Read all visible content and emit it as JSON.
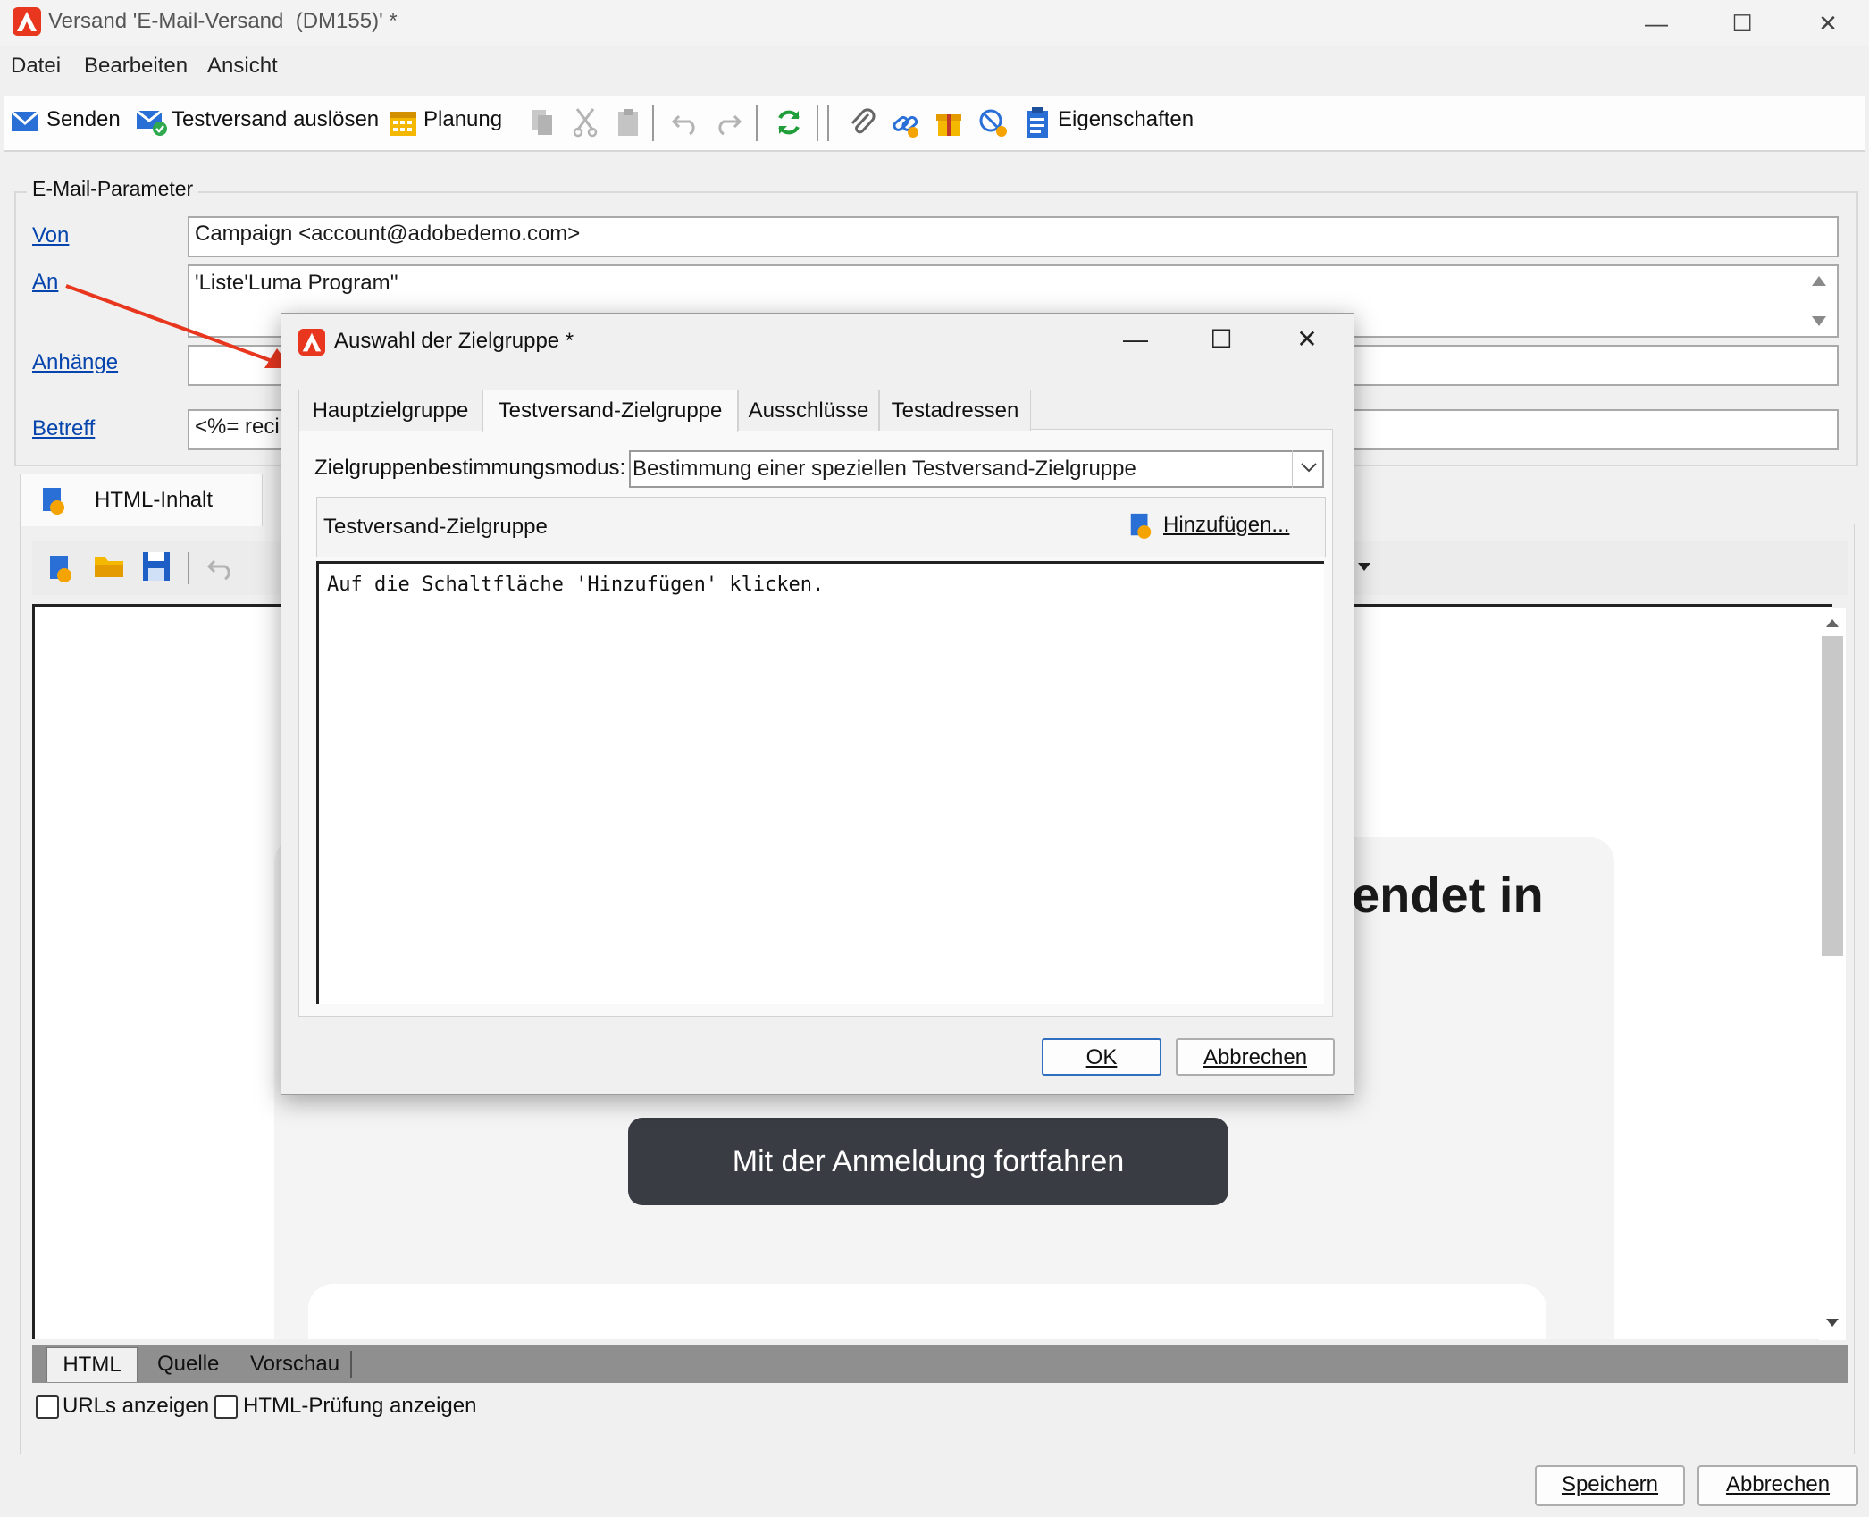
{
  "window": {
    "title": "Versand 'E-Mail-Versand  (DM155)' *",
    "controls": {
      "minimize": "—",
      "maximize": "☐",
      "close": "✕"
    }
  },
  "menu": {
    "items": [
      "Datei",
      "Bearbeiten",
      "Ansicht"
    ]
  },
  "toolbar": {
    "send_label": "Senden",
    "proof_label": "Testversand auslösen",
    "schedule_label": "Planung",
    "properties_label": "Eigenschaften"
  },
  "params": {
    "legend": "E-Mail-Parameter",
    "from_link": "Von",
    "from_value": "Campaign <account@adobedemo.com>",
    "to_link": "An",
    "to_value": "'Liste'Luma Program''",
    "attachments_link": "Anhänge",
    "attachments_value": "",
    "subject_link": "Betreff",
    "subject_value": "<%= reci"
  },
  "content": {
    "tab_label": "HTML-Inhalt",
    "preview_heading": "endet in",
    "preview_button": "Mit der Anmeldung fortfahren",
    "view_tabs": [
      "HTML",
      "Quelle",
      "Vorschau"
    ],
    "show_urls_label": "URLs anzeigen",
    "show_html_check_label": "HTML-Prüfung anzeigen"
  },
  "footer": {
    "save_label": "Speichern",
    "cancel_label": "Abbrechen"
  },
  "dialog": {
    "title": "Auswahl der Zielgruppe *",
    "tabs": [
      "Hauptzielgruppe",
      "Testversand-Zielgruppe",
      "Ausschlüsse",
      "Testadressen"
    ],
    "active_tab": "Testversand-Zielgruppe",
    "mode_label": "Zielgruppenbestimmungsmodus:",
    "mode_value": "Bestimmung einer speziellen Testversand-Zielgruppe",
    "target_header": "Testversand-Zielgruppe",
    "add_label": "Hinzufügen...",
    "hint": "Auf die Schaltfläche 'Hinzufügen' klicken.",
    "ok_label": "OK",
    "cancel_label": "Abbrechen"
  },
  "colors": {
    "accent_red": "#e8361f",
    "link_blue": "#0645ad",
    "preview_button": "#3a3c44"
  }
}
